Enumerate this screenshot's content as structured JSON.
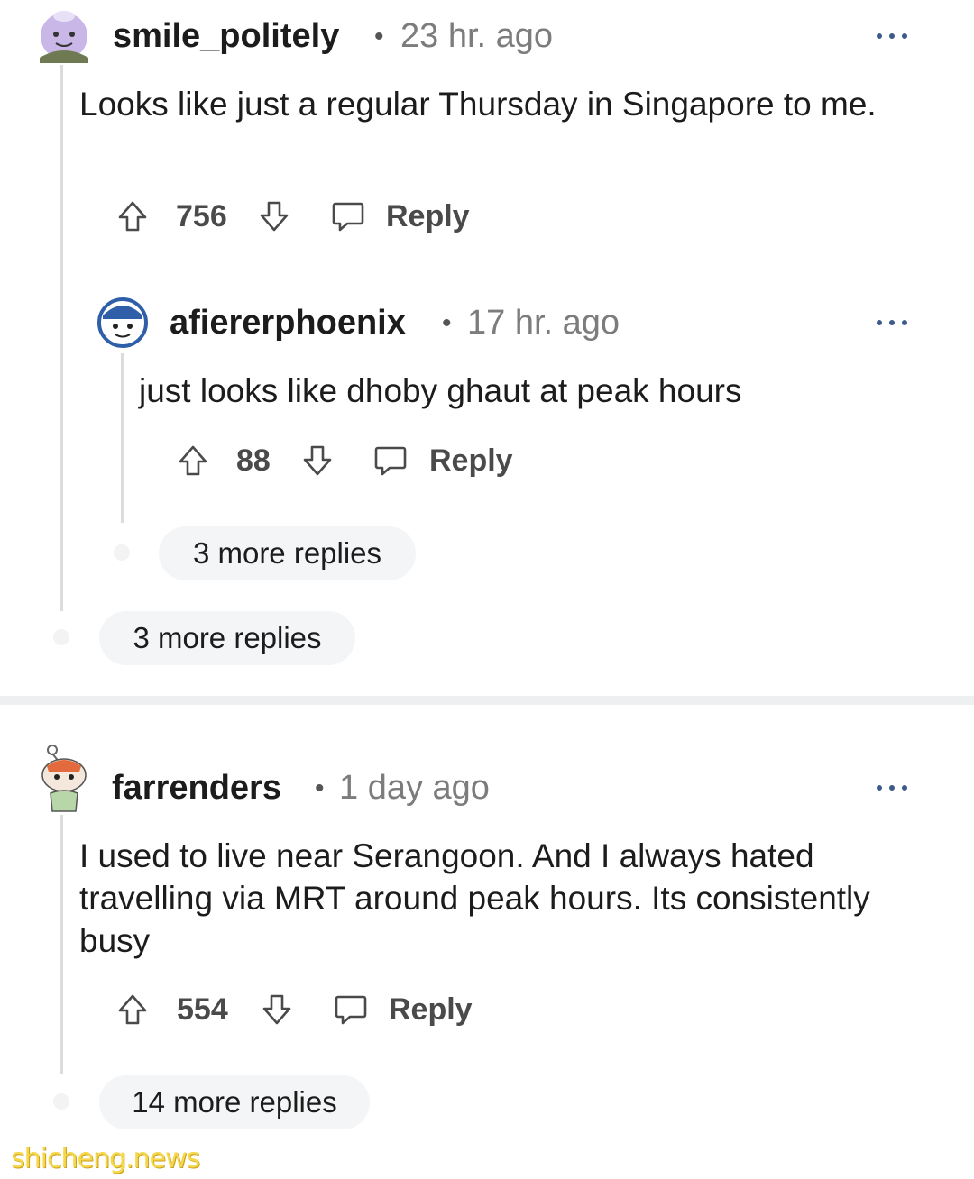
{
  "comments": [
    {
      "username": "smile_politely",
      "time": "23 hr. ago",
      "body": "Looks like just a regular Thursday in Singapore to me.",
      "votes": "756",
      "reply_label": "Reply",
      "more_replies": "3 more replies"
    },
    {
      "username": "afiererphoenix",
      "time": "17 hr. ago",
      "body": "just looks like dhoby ghaut at peak hours",
      "votes": "88",
      "reply_label": "Reply",
      "more_replies": "3 more replies"
    },
    {
      "username": "farrenders",
      "time": "1 day ago",
      "body": "I used to live near Serangoon. And I always hated travelling via MRT around peak hours. Its consistently busy",
      "votes": "554",
      "reply_label": "Reply",
      "more_replies": "14 more replies"
    }
  ],
  "separator": "•",
  "watermark": "shicheng.news",
  "icons": {
    "upvote": "upvote-arrow-icon",
    "downvote": "downvote-arrow-icon",
    "reply": "speech-bubble-icon",
    "more": "more-options-icon"
  },
  "colors": {
    "accent_dots": "#3c5a8a",
    "pill_bg": "#f4f5f7",
    "divider": "#edeff1",
    "watermark": "#f6d64a"
  }
}
